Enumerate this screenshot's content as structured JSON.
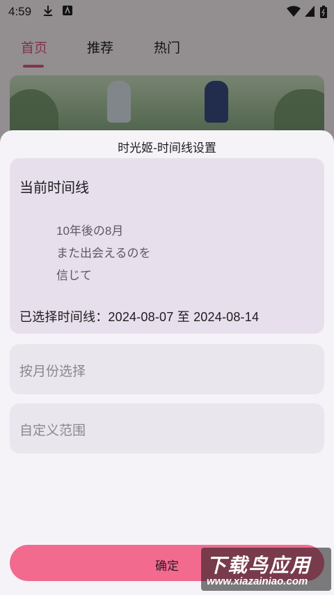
{
  "status_bar": {
    "time": "4:59",
    "download_icon": "download-icon",
    "notification_icon": "app-notification-icon",
    "wifi_icon": "wifi-icon",
    "battery_icon": "battery-icon"
  },
  "tabs": [
    {
      "label": "首页",
      "active": true
    },
    {
      "label": "推荐",
      "active": false
    },
    {
      "label": "热门",
      "active": false
    }
  ],
  "sheet": {
    "title": "时光姬-时间线设置",
    "current": {
      "heading": "当前时间线",
      "lyrics": [
        "10年後の8月",
        "また出会えるのを",
        "信じて"
      ],
      "selected_text": "已选择时间线：2024-08-07 至 2024-08-14"
    },
    "options": [
      {
        "label": "按月份选择"
      },
      {
        "label": "自定义范围"
      }
    ],
    "confirm_label": "确定"
  },
  "watermark": {
    "main": "下载鸟应用",
    "sub": "www.xiazainiao.com"
  },
  "colors": {
    "accent": "#e2587b",
    "confirm_button": "#f26b8f",
    "card_bg": "#e7e0ec",
    "sheet_bg": "#f6f3f8"
  }
}
